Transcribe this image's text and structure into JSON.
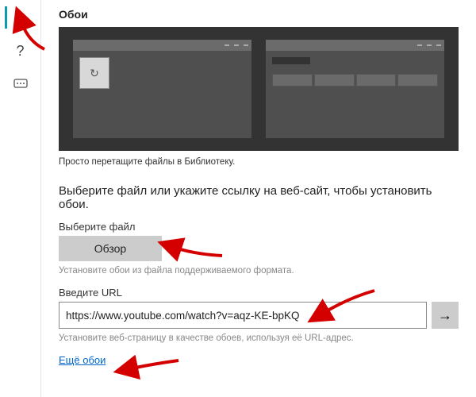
{
  "sidebar": {
    "add_label": "+",
    "help_label": "?",
    "feedback_label": "⋯"
  },
  "page_title": "Обои",
  "preview_caption": "Просто перетащите файлы в Библиотеку.",
  "description": "Выберите файл или укажите ссылку на веб-сайт, чтобы установить обои.",
  "file_section": {
    "label": "Выберите файл",
    "browse": "Обзор",
    "hint": "Установите обои из файла поддерживаемого формата."
  },
  "url_section": {
    "label": "Введите URL",
    "value": "https://www.youtube.com/watch?v=aqz-KE-bpKQ",
    "go": "→",
    "hint": "Установите веб-страницу в качестве обоев, используя её URL-адрес."
  },
  "more_link": "Ещё обои"
}
